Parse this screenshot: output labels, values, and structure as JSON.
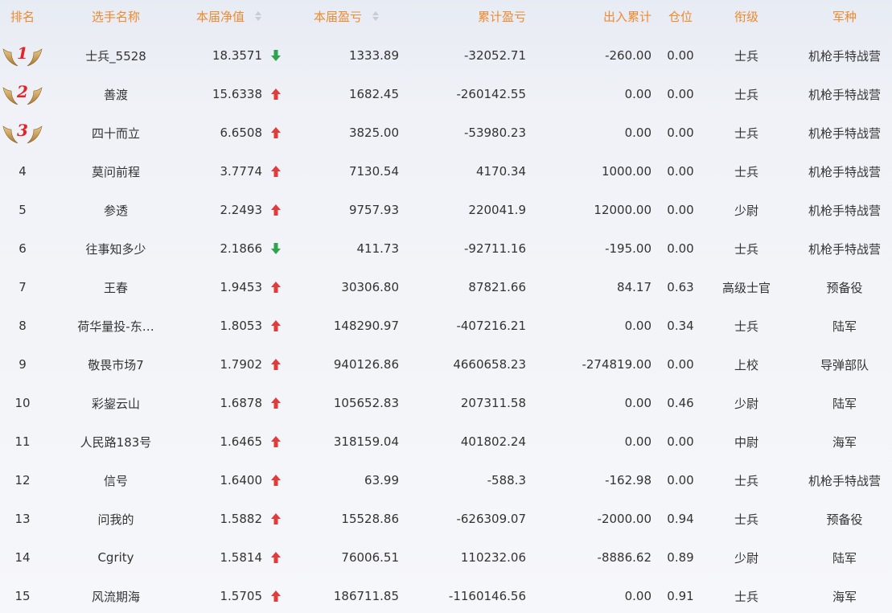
{
  "header": {
    "rank": "排名",
    "name": "选手名称",
    "nav": "本届净值",
    "pnl": "本届盈亏",
    "cum": "累计盈亏",
    "flow": "出入累计",
    "pos": "仓位",
    "grade": "衔级",
    "branch": "军种"
  },
  "colors": {
    "header_text": "#ee8a2f",
    "arrow_up": "#e23b3b",
    "arrow_down": "#2ea44f",
    "rank_medal_number": "#e0252b"
  },
  "rows": [
    {
      "rank": "1",
      "name": "士兵_5528",
      "nav": "18.3571",
      "trend": "down",
      "pnl": "1333.89",
      "cum": "-32052.71",
      "flow": "-260.00",
      "pos": "0.00",
      "grade": "士兵",
      "branch": "机枪手特战营",
      "medal": true
    },
    {
      "rank": "2",
      "name": "善渡",
      "nav": "15.6338",
      "trend": "up",
      "pnl": "1682.45",
      "cum": "-260142.55",
      "flow": "0.00",
      "pos": "0.00",
      "grade": "士兵",
      "branch": "机枪手特战营",
      "medal": true
    },
    {
      "rank": "3",
      "name": "四十而立",
      "nav": "6.6508",
      "trend": "up",
      "pnl": "3825.00",
      "cum": "-53980.23",
      "flow": "0.00",
      "pos": "0.00",
      "grade": "士兵",
      "branch": "机枪手特战营",
      "medal": true
    },
    {
      "rank": "4",
      "name": "莫问前程",
      "nav": "3.7774",
      "trend": "up",
      "pnl": "7130.54",
      "cum": "4170.34",
      "flow": "1000.00",
      "pos": "0.00",
      "grade": "士兵",
      "branch": "机枪手特战营",
      "medal": false
    },
    {
      "rank": "5",
      "name": "参透",
      "nav": "2.2493",
      "trend": "up",
      "pnl": "9757.93",
      "cum": "220041.9",
      "flow": "12000.00",
      "pos": "0.00",
      "grade": "少尉",
      "branch": "机枪手特战营",
      "medal": false
    },
    {
      "rank": "6",
      "name": "往事知多少",
      "nav": "2.1866",
      "trend": "down",
      "pnl": "411.73",
      "cum": "-92711.16",
      "flow": "-195.00",
      "pos": "0.00",
      "grade": "士兵",
      "branch": "机枪手特战营",
      "medal": false
    },
    {
      "rank": "7",
      "name": "王春",
      "nav": "1.9453",
      "trend": "up",
      "pnl": "30306.80",
      "cum": "87821.66",
      "flow": "84.17",
      "pos": "0.63",
      "grade": "高级士官",
      "branch": "预备役",
      "medal": false
    },
    {
      "rank": "8",
      "name": "荷华量投-东…",
      "nav": "1.8053",
      "trend": "up",
      "pnl": "148290.97",
      "cum": "-407216.21",
      "flow": "0.00",
      "pos": "0.34",
      "grade": "士兵",
      "branch": "陆军",
      "medal": false
    },
    {
      "rank": "9",
      "name": "敬畏市场7",
      "nav": "1.7902",
      "trend": "up",
      "pnl": "940126.86",
      "cum": "4660658.23",
      "flow": "-274819.00",
      "pos": "0.00",
      "grade": "上校",
      "branch": "导弹部队",
      "medal": false
    },
    {
      "rank": "10",
      "name": "彩鋆云山",
      "nav": "1.6878",
      "trend": "up",
      "pnl": "105652.83",
      "cum": "207311.58",
      "flow": "0.00",
      "pos": "0.46",
      "grade": "少尉",
      "branch": "陆军",
      "medal": false
    },
    {
      "rank": "11",
      "name": "人民路183号",
      "nav": "1.6465",
      "trend": "up",
      "pnl": "318159.04",
      "cum": "401802.24",
      "flow": "0.00",
      "pos": "0.00",
      "grade": "中尉",
      "branch": "海军",
      "medal": false
    },
    {
      "rank": "12",
      "name": "信号",
      "nav": "1.6400",
      "trend": "up",
      "pnl": "63.99",
      "cum": "-588.3",
      "flow": "-162.98",
      "pos": "0.00",
      "grade": "士兵",
      "branch": "机枪手特战营",
      "medal": false
    },
    {
      "rank": "13",
      "name": "问我的",
      "nav": "1.5882",
      "trend": "up",
      "pnl": "15528.86",
      "cum": "-626309.07",
      "flow": "-2000.00",
      "pos": "0.94",
      "grade": "士兵",
      "branch": "预备役",
      "medal": false
    },
    {
      "rank": "14",
      "name": "Cgrity",
      "nav": "1.5814",
      "trend": "up",
      "pnl": "76006.51",
      "cum": "110232.06",
      "flow": "-8886.62",
      "pos": "0.89",
      "grade": "少尉",
      "branch": "陆军",
      "medal": false
    },
    {
      "rank": "15",
      "name": "风流期海",
      "nav": "1.5705",
      "trend": "up",
      "pnl": "186711.85",
      "cum": "-1160146.56",
      "flow": "0.00",
      "pos": "0.91",
      "grade": "士兵",
      "branch": "海军",
      "medal": false
    }
  ]
}
